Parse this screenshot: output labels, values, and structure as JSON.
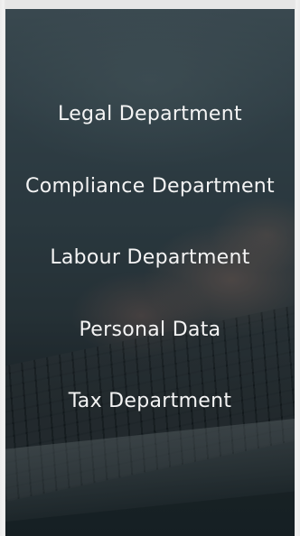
{
  "menu": {
    "items": [
      {
        "label": "Legal Department"
      },
      {
        "label": "Compliance Department"
      },
      {
        "label": "Labour Department"
      },
      {
        "label": "Personal Data"
      },
      {
        "label": "Tax Department"
      }
    ]
  },
  "colors": {
    "text": "#f4f4f4",
    "overlay": "#142026"
  }
}
